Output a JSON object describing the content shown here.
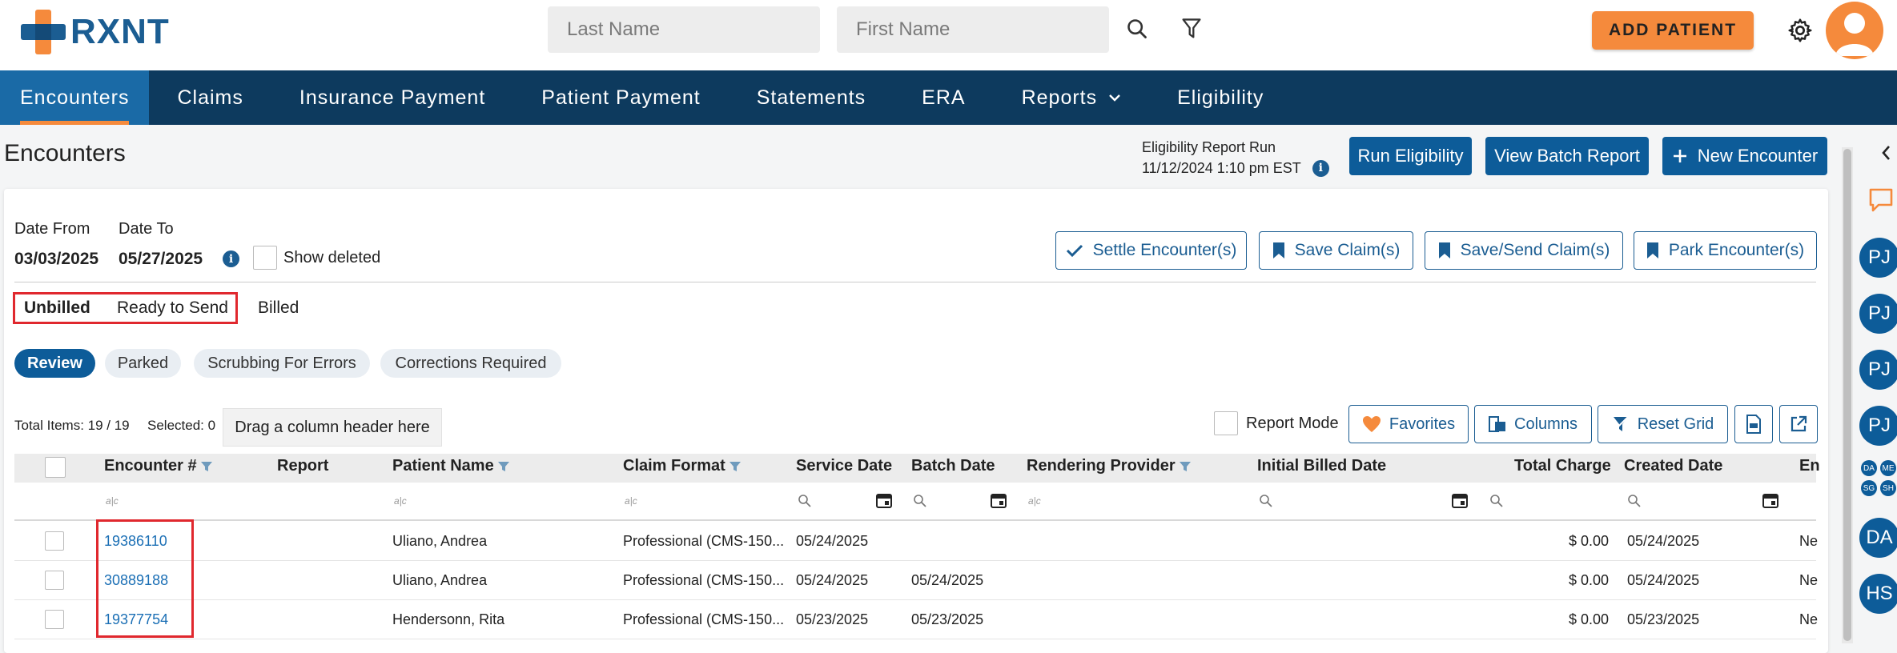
{
  "app": {
    "logo_text": "RXNT"
  },
  "header": {
    "last_name_placeholder": "Last Name",
    "first_name_placeholder": "First Name",
    "add_patient_label": "ADD PATIENT"
  },
  "nav": {
    "items": [
      {
        "label": "Encounters"
      },
      {
        "label": "Claims"
      },
      {
        "label": "Insurance Payment"
      },
      {
        "label": "Patient Payment"
      },
      {
        "label": "Statements"
      },
      {
        "label": "ERA"
      },
      {
        "label": "Reports"
      },
      {
        "label": "Eligibility"
      }
    ]
  },
  "page": {
    "title": "Encounters",
    "eligibility_report_label": "Eligibility Report Run",
    "eligibility_report_time": "11/12/2024 1:10 pm EST",
    "run_eligibility": "Run Eligibility",
    "view_batch_report": "View Batch Report",
    "new_encounter": "New Encounter"
  },
  "filters": {
    "date_from_label": "Date From",
    "date_from_value": "03/03/2025",
    "date_to_label": "Date To",
    "date_to_value": "05/27/2025",
    "show_deleted_label": "Show deleted"
  },
  "actions": {
    "settle": "Settle Encounter(s)",
    "save_claim": "Save Claim(s)",
    "save_send": "Save/Send Claim(s)",
    "park": "Park Encounter(s)"
  },
  "tabs": [
    {
      "label": "Unbilled"
    },
    {
      "label": "Ready to Send"
    },
    {
      "label": "Billed"
    }
  ],
  "pills": [
    {
      "label": "Review"
    },
    {
      "label": "Parked"
    },
    {
      "label": "Scrubbing For Errors"
    },
    {
      "label": "Corrections Required"
    }
  ],
  "grid": {
    "total_items": "Total Items: 19 / 19",
    "selected": "Selected: 0",
    "drag_hint": "Drag a column header here",
    "report_mode": "Report Mode",
    "favorites": "Favorites",
    "columns": "Columns",
    "reset_grid": "Reset Grid",
    "filter_abc": "a|c",
    "headers": [
      "Encounter #",
      "Report",
      "Patient Name",
      "Claim Format",
      "Service Date",
      "Batch Date",
      "Rendering Provider",
      "Initial Billed Date",
      "Total Charge",
      "Created Date",
      "En"
    ],
    "rows": [
      {
        "encounter": "19386110",
        "patient": "Uliano, Andrea",
        "claim_format": "Professional (CMS-150...",
        "service_date": "05/24/2025",
        "batch_date": "",
        "total": "$ 0.00",
        "created": "05/24/2025",
        "en": "Ne"
      },
      {
        "encounter": "30889188",
        "patient": "Uliano, Andrea",
        "claim_format": "Professional (CMS-150...",
        "service_date": "05/24/2025",
        "batch_date": "05/24/2025",
        "total": "$ 0.00",
        "created": "05/24/2025",
        "en": "Ne"
      },
      {
        "encounter": "19377754",
        "patient": "Hendersonn, Rita",
        "claim_format": "Professional (CMS-150...",
        "service_date": "05/23/2025",
        "batch_date": "05/23/2025",
        "total": "$ 0.00",
        "created": "05/23/2025",
        "en": "Ne"
      }
    ]
  },
  "right_rail": {
    "avatars": [
      "PJ",
      "PJ",
      "PJ",
      "PJ",
      "DA",
      "HS"
    ],
    "mini": [
      "DA",
      "ME",
      "SG",
      "SH"
    ]
  },
  "colors": {
    "brand": "#1b5d92",
    "accent": "#f58a3c",
    "nav": "#0d3a5e",
    "highlight": "#e0282e"
  }
}
